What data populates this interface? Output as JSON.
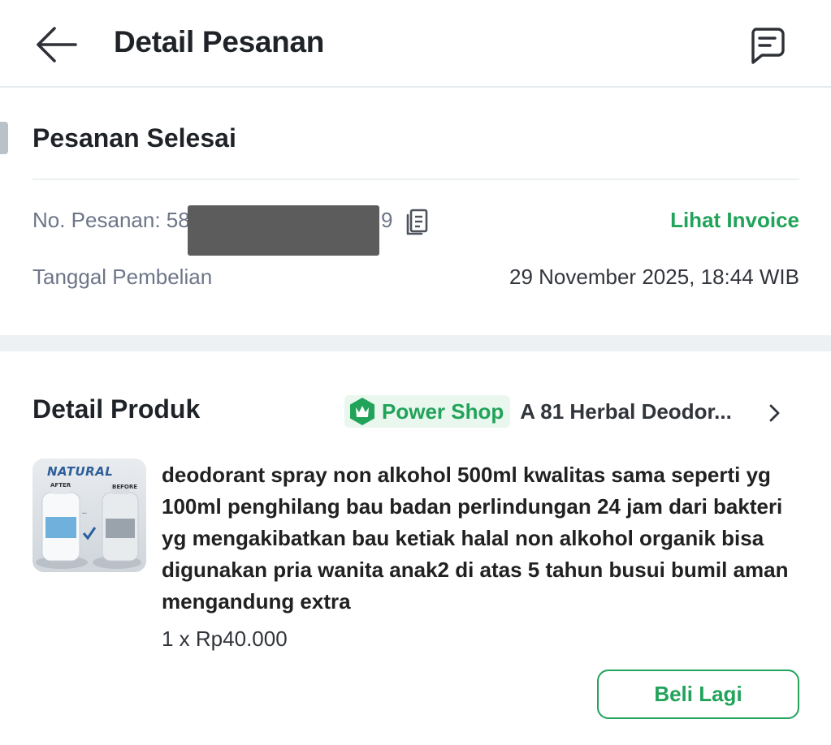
{
  "header": {
    "title": "Detail Pesanan",
    "back_icon": "arrow-left-icon",
    "chat_icon": "chat-bubble-icon"
  },
  "status": {
    "title": "Pesanan Selesai"
  },
  "order": {
    "number_label": "No. Pesanan: 58",
    "number_suffix": "9",
    "copy_icon": "copy-icon",
    "invoice_label": "Lihat Invoice",
    "date_label": "Tanggal Pembelian",
    "date_value": "29 November 2025, 18:44 WIB"
  },
  "product_section": {
    "title": "Detail Produk",
    "badge_label": "Power Shop",
    "badge_icon": "power-shop-badge-icon",
    "shop_name": "A 81 Herbal Deodor...",
    "chevron_icon": "chevron-right-icon",
    "thumbnail": {
      "brand_text": "NATURAL",
      "after_label": "AFTER",
      "before_label": "BEFORE"
    },
    "product_name": "deodorant spray non alkohol 500ml kwalitas sama seperti yg 100ml penghilang bau badan perlindungan 24 jam dari bakteri yg mengakibatkan bau ketiak halal non alkohol organik bisa digunakan pria wanita anak2 di atas 5 tahun busui bumil aman mengandung extra",
    "price": "1 x Rp40.000",
    "buy_again_label": "Beli Lagi"
  },
  "colors": {
    "accent_green": "#21a35a",
    "text_dark": "#1f2328",
    "text_muted": "#6d7588"
  }
}
